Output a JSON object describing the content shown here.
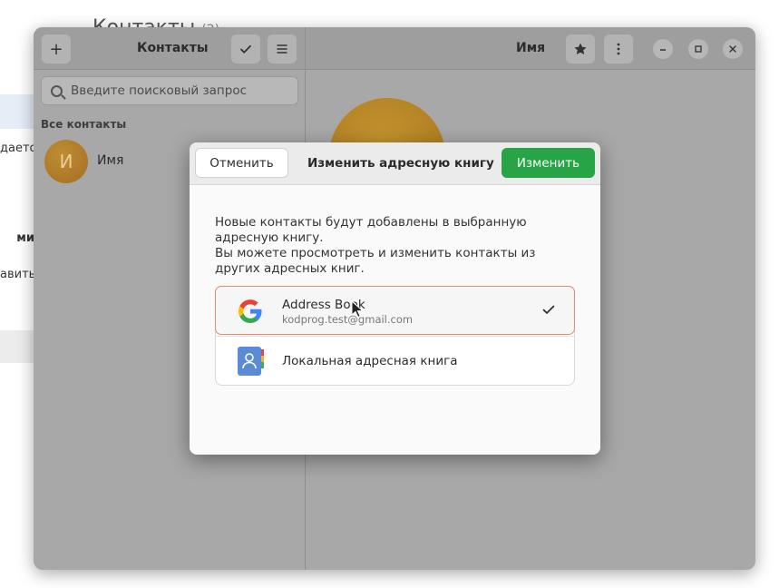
{
  "background_window": {
    "title": "Контакты",
    "count": "(2)",
    "fragments": [
      "дается",
      "ми",
      "авить"
    ]
  },
  "window": {
    "sidebar_title": "Контакты",
    "detail_title": "Имя",
    "search_placeholder": "Введите поисковый запрос",
    "section_label": "Все контакты",
    "contacts": [
      {
        "initial": "И",
        "name": "Имя"
      }
    ]
  },
  "dialog": {
    "cancel_label": "Отменить",
    "title": "Изменить адресную книгу",
    "ok_label": "Изменить",
    "text_line1": "Новые контакты будут добавлены в выбранную адресную книгу.",
    "text_line2": "Вы можете просмотреть и изменить контакты из других адресных книг.",
    "address_books": [
      {
        "name": "Address Book",
        "account": "kodprog.test@gmail.com",
        "icon": "google-icon",
        "selected": true
      },
      {
        "name": "Локальная адресная книга",
        "account": "",
        "icon": "local-address-book-icon",
        "selected": false
      }
    ]
  },
  "colors": {
    "accent_green": "#26a446",
    "selection_border": "#e58a6d",
    "avatar": "#b27c2a"
  }
}
